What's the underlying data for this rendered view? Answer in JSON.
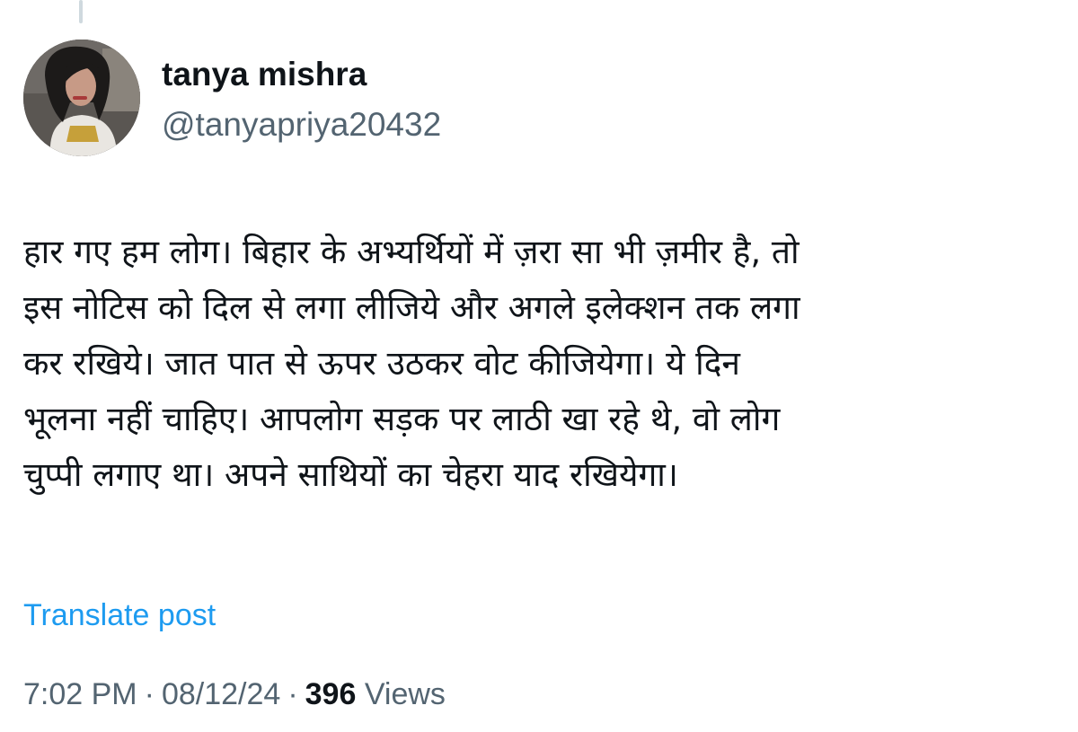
{
  "post": {
    "author": {
      "display_name": "tanya mishra",
      "handle": "@tanyapriya20432",
      "avatar": "profile-photo"
    },
    "text_lines": [
      "हार गए हम लोग। बिहार के अभ्यर्थियों में ज़रा सा भी ज़मीर है, तो",
      "इस नोटिस को दिल से लगा लीजिये और अगले इलेक्शन तक लगा",
      "कर रखिये। जात पात से ऊपर उठकर वोट कीजियेगा। ये दिन",
      "भूलना नहीं चाहिए। आपलोग सड़क पर लाठी खा रहे थे, वो लोग",
      "चुप्पी लगाए था। अपने साथियों का चेहरा याद रखियेगा।"
    ],
    "translate_label": "Translate post",
    "meta": {
      "time": "7:02 PM",
      "separator": "·",
      "date": "08/12/24",
      "views_count": "396",
      "views_label": "Views"
    }
  },
  "colors": {
    "text_primary": "#0f1419",
    "text_secondary": "#536471",
    "link": "#1d9bf0",
    "thread_line": "#cfd9de"
  }
}
